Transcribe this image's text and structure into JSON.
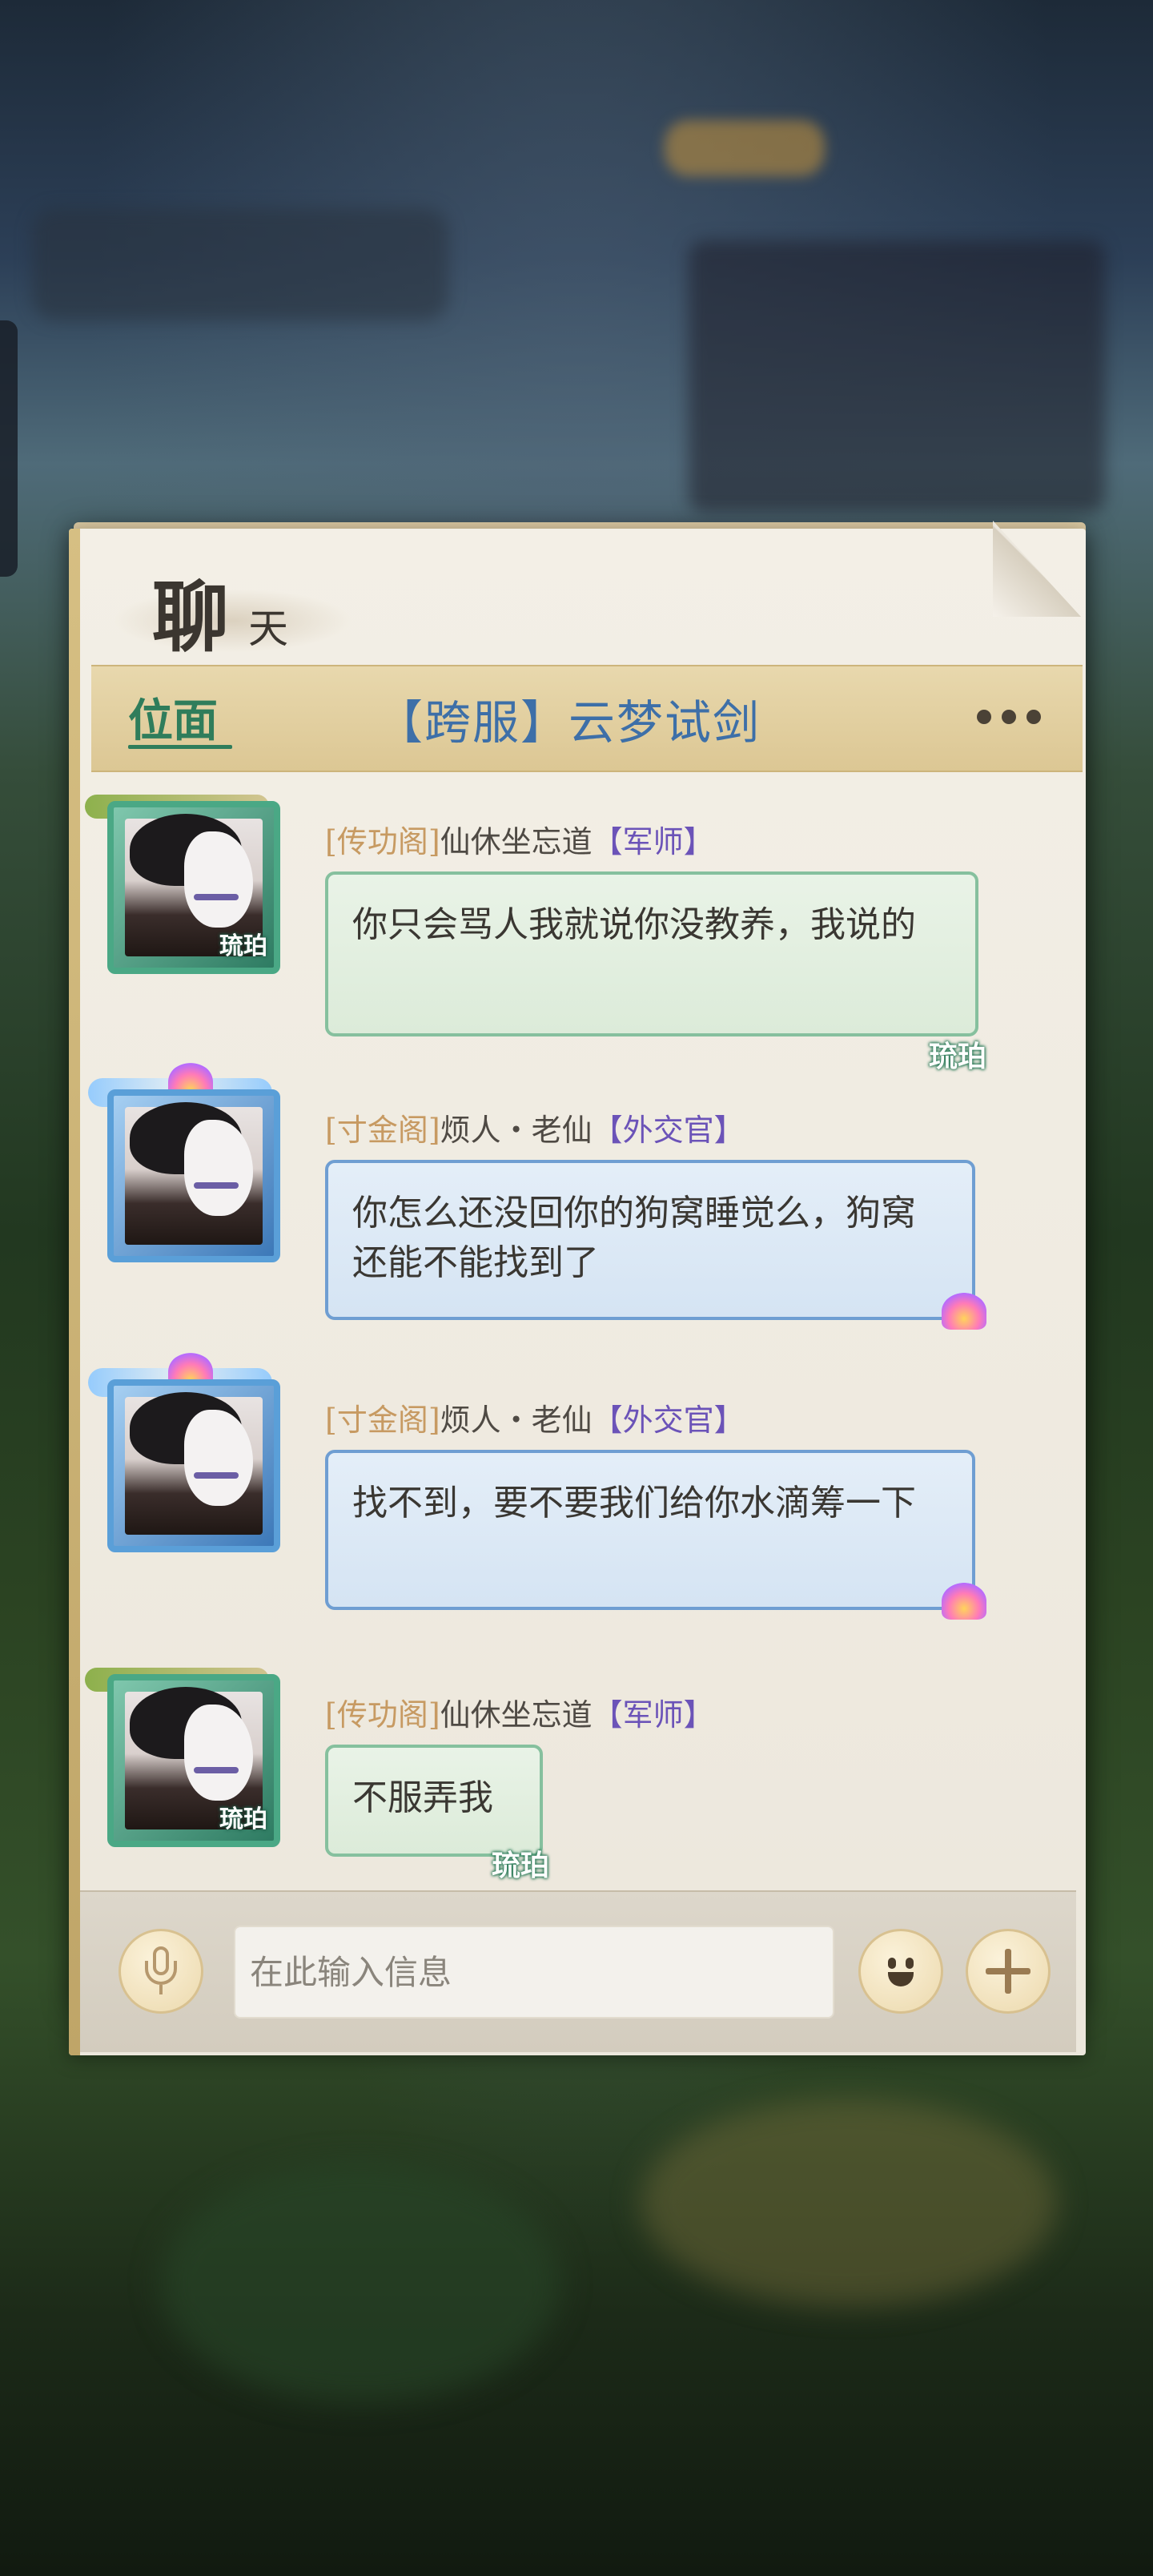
{
  "panel": {
    "title_main": "聊",
    "title_sub": "天"
  },
  "tabs": {
    "active": "位面",
    "channel": "【跨服】云梦试剑"
  },
  "messages": [
    {
      "guild": "[传功阁]",
      "name": "仙休坐忘道",
      "role": "【军师】",
      "avatar_tag": "琉珀",
      "bubble_tag": "琉珀",
      "style": "green",
      "text": "你只会骂人我就说你没教养，我说的"
    },
    {
      "guild": "[寸金阁]",
      "name": "烦人・老仙",
      "role": "【外交官】",
      "style": "blue",
      "text": "你怎么还没回你的狗窝睡觉么，狗窝还能不能找到了"
    },
    {
      "guild": "[寸金阁]",
      "name": "烦人・老仙",
      "role": "【外交官】",
      "style": "blue",
      "text": "找不到，要不要我们给你水滴筹一下"
    },
    {
      "guild": "[传功阁]",
      "name": "仙休坐忘道",
      "role": "【军师】",
      "avatar_tag": "琉珀",
      "bubble_tag": "琉珀",
      "style": "green",
      "text": "不服弄我"
    }
  ],
  "input": {
    "placeholder": "在此输入信息",
    "value": ""
  },
  "icons": {
    "mic": "microphone-icon",
    "emoji": "emoji-icon",
    "plus": "plus-icon",
    "more": "more-dots-icon"
  },
  "colors": {
    "accent_green": "#2f7d5b",
    "channel_blue": "#3d6fa8",
    "role_purple": "#6b53b8",
    "guild_gold": "#c79a62"
  }
}
